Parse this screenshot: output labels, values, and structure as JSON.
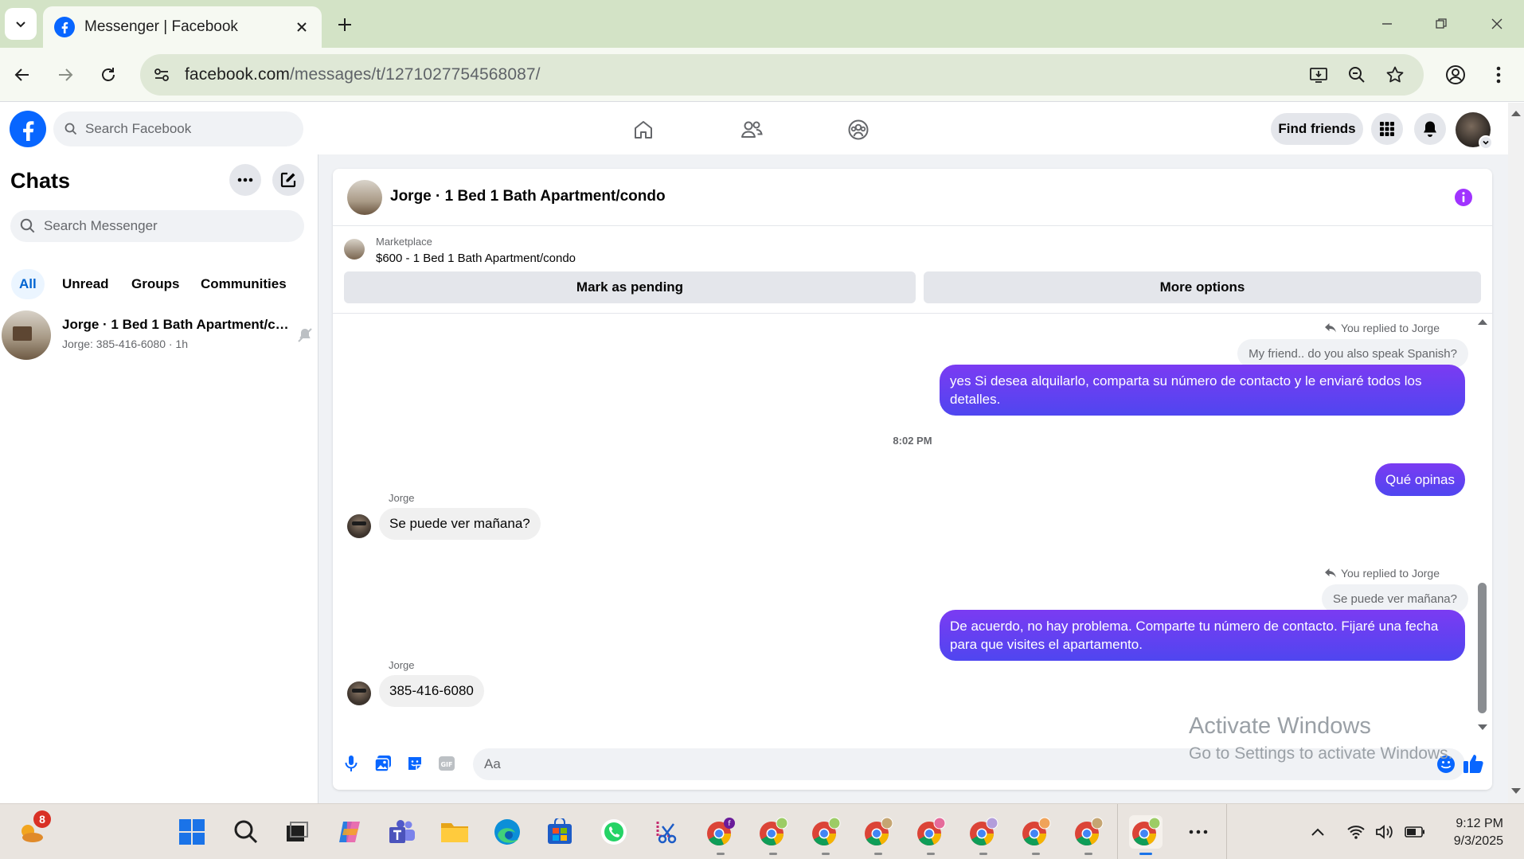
{
  "browser": {
    "tab_title": "Messenger | Facebook",
    "url_host": "facebook.com",
    "url_path": "/messages/t/1271027754568087/"
  },
  "fb_header": {
    "search_placeholder": "Search Facebook",
    "find_friends_label": "Find friends"
  },
  "sidebar": {
    "title": "Chats",
    "search_placeholder": "Search Messenger",
    "filters": [
      "All",
      "Unread",
      "Groups",
      "Communities"
    ],
    "active_filter": "All",
    "conversations": [
      {
        "name": "Jorge · 1 Bed 1 Bath Apartment/condo",
        "preview": "Jorge: 385-416-6080 · 1h"
      }
    ]
  },
  "chat": {
    "title": "Jorge · 1 Bed 1 Bath Apartment/condo",
    "marketplace_label": "Marketplace",
    "listing": "$600 - 1 Bed 1 Bath Apartment/condo",
    "mark_pending_label": "Mark as pending",
    "more_options_label": "More options",
    "messages": [
      {
        "reply_note": "You replied to Jorge",
        "quoted": "My friend.. do you also speak Spanish?",
        "text": "yes Si desea alquilarlo, comparta su número de contacto y le enviaré todos los detalles."
      },
      {
        "timestamp": "8:02 PM"
      },
      {
        "text": "Qué opinas"
      },
      {
        "sender": "Jorge",
        "text": "Se puede ver mañana?"
      },
      {
        "reply_note": "You replied to Jorge",
        "quoted": "Se puede ver mañana?",
        "text": "De acuerdo, no hay problema. Comparte tu número de contacto. Fijaré una fecha para que visites el apartamento."
      },
      {
        "sender": "Jorge",
        "text": "385-416-6080"
      }
    ],
    "composer_placeholder": "Aa",
    "accent_color": "#6b3ff0"
  },
  "watermark": {
    "line1": "Activate Windows",
    "line2": "Go to Settings to activate Windows."
  },
  "taskbar": {
    "weather_badge": "8",
    "time": "9:12 PM",
    "date": "9/3/2025"
  }
}
